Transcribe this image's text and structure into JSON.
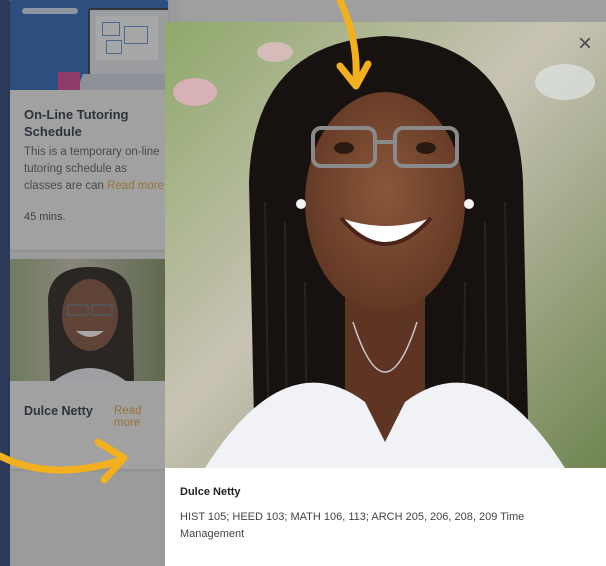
{
  "cards": [
    {
      "title": "On-Line Tutoring Schedule",
      "description": "This is a temporary on-line tutoring schedule as classes are can",
      "read_more": "Read more",
      "duration": "45 mins."
    },
    {
      "name": "Dulce Netty",
      "read_more": "Read more"
    }
  ],
  "modal": {
    "name": "Dulce Netty",
    "description": "HIST 105; HEED 103; MATH 106, 113; ARCH 205, 206, 208, 209 Time Management",
    "close_label": "×"
  },
  "colors": {
    "accent": "#f2b01e",
    "rail": "#1d3a70",
    "read_more": "#e2a23a"
  }
}
